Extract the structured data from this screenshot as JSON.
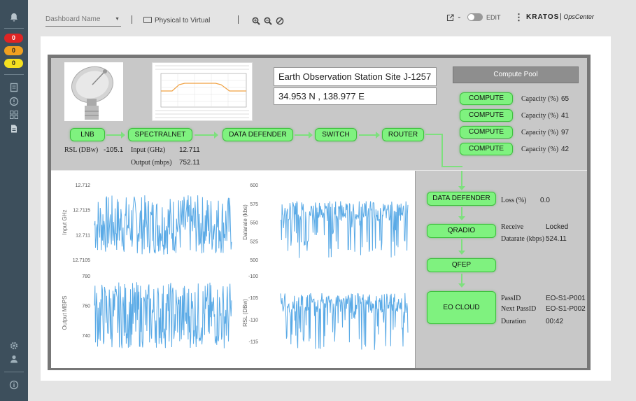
{
  "sidebar": {
    "badges": [
      {
        "label": "0",
        "color": "#e02424",
        "text_color": "#ffffff"
      },
      {
        "label": "0",
        "color": "#f0a020",
        "text_color": "#222222"
      },
      {
        "label": "0",
        "color": "#f5e020",
        "text_color": "#222222"
      }
    ],
    "icons": [
      "bell-icon",
      "clipboard-icon",
      "alert-icon",
      "grid-icon",
      "document-icon",
      "settings-icon",
      "user-icon",
      "info-icon"
    ]
  },
  "header": {
    "dashboard_placeholder": "Dashboard Name",
    "physical_to_virtual": "Physical to Virtual",
    "edit_label": "EDIT",
    "brand": "KRATOS",
    "brand_suffix": "OpsCenter"
  },
  "station": {
    "name": "Earth Observation Station Site J-1257",
    "coordinates": "34.953 N , 138.977 E"
  },
  "chain": {
    "nodes": [
      "LNB",
      "SPECTRALNET",
      "DATA DEFENDER",
      "SWITCH",
      "ROUTER"
    ],
    "rsl_label": "RSL (DBw)",
    "rsl_value": "-105.1",
    "input_label": "Input (GHz)",
    "input_value": "12.711",
    "output_label": "Output (mbps)",
    "output_value": "752.11"
  },
  "compute_pool": {
    "title": "Compute Pool",
    "items": [
      {
        "label": "COMPUTE",
        "cap_label": "Capacity (%)",
        "cap_value": "65"
      },
      {
        "label": "COMPUTE",
        "cap_label": "Capacity (%)",
        "cap_value": "41"
      },
      {
        "label": "COMPUTE",
        "cap_label": "Capacity (%)",
        "cap_value": "97"
      },
      {
        "label": "COMPUTE",
        "cap_label": "Capacity (%)",
        "cap_value": "42"
      }
    ]
  },
  "downstream": {
    "data_defender": "DATA DEFENDER",
    "loss_label": "Loss (%)",
    "loss_value": "0.0",
    "qradio": "QRADIO",
    "receive_label": "Receive",
    "receive_value": "Locked",
    "datarate_label": "Datarate (kbps)",
    "datarate_value": "524.11",
    "qfep": "QFEP",
    "eo_cloud": "EO CLOUD",
    "passid_label": "PassID",
    "passid_value": "EO-S1-P001",
    "next_passid_label": "Next PassID",
    "next_passid_value": "EO-S1-P002",
    "duration_label": "Duration",
    "duration_value": "00:42"
  },
  "chart_data": [
    {
      "type": "line",
      "ylabel": "Input GHz",
      "yticks": [
        "12.712",
        "12.7115",
        "12.711",
        "12.7105"
      ],
      "ylim": [
        12.7105,
        12.712
      ],
      "series_color": "#5aaae6",
      "range": [
        12.7106,
        12.7118
      ]
    },
    {
      "type": "line",
      "ylabel": "Datarate (kbs)",
      "yticks": [
        "600",
        "575",
        "550",
        "525",
        "500"
      ],
      "ylim": [
        500,
        600
      ],
      "series_color": "#5aaae6",
      "range": [
        502,
        578
      ]
    },
    {
      "type": "line",
      "ylabel": "Output MBPS",
      "yticks": [
        "780",
        "760",
        "740"
      ],
      "ylim": [
        730,
        780
      ],
      "series_color": "#5aaae6",
      "range": [
        731,
        776
      ]
    },
    {
      "type": "line",
      "ylabel": "RSL (DBw)",
      "yticks": [
        "-100",
        "-105",
        "-110",
        "-115"
      ],
      "ylim": [
        -117,
        -100
      ],
      "series_color": "#5aaae6",
      "range": [
        -117,
        -104
      ]
    }
  ]
}
